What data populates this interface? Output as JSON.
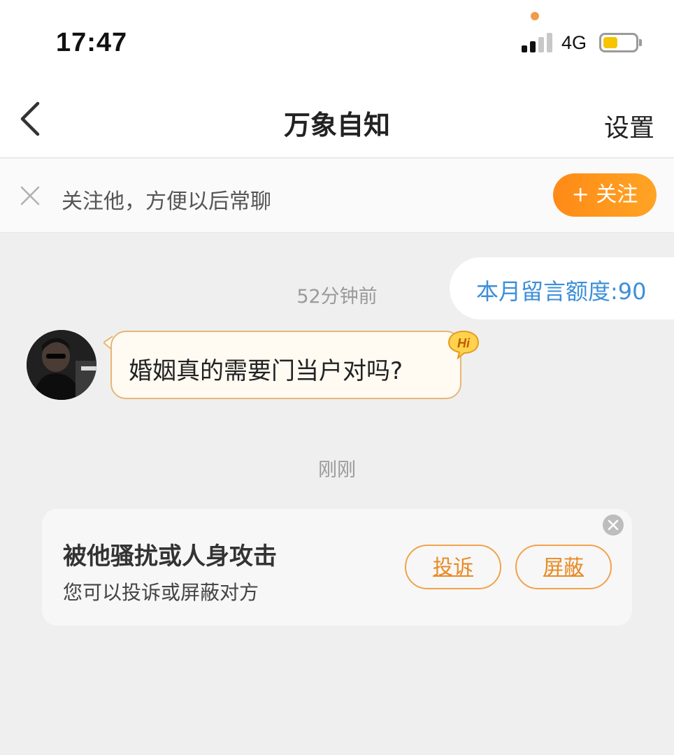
{
  "status_bar": {
    "time": "17:47",
    "network": "4G",
    "signal_bars_active": 2,
    "signal_bars_total": 4,
    "battery_level_percent": 45,
    "battery_color": "#f6c400",
    "dot_color": "#f19a4a"
  },
  "nav": {
    "back_icon": "chevron-left-icon",
    "title": "万象自知",
    "settings_label": "设置"
  },
  "follow_bar": {
    "close_icon": "close-icon",
    "text": "关注他，方便以后常聊",
    "button_label": "+ 关注",
    "button_color": "#ff8a17"
  },
  "quota": {
    "text": "本月留言额度:90",
    "color": "#3d8fd8"
  },
  "messages": [
    {
      "timestamp": "52分钟前",
      "sender": "other",
      "avatar_icon": "user-avatar",
      "text": "婚姻真的需要门当户对吗?",
      "badge": "Hi"
    }
  ],
  "system_timestamp": "刚刚",
  "warning_card": {
    "title": "被他骚扰或人身攻击",
    "subtitle": "您可以投诉或屏蔽对方",
    "report_label": "投诉",
    "block_label": "屏蔽",
    "accent_color": "#e88a23",
    "close_icon": "close-circle-icon"
  }
}
